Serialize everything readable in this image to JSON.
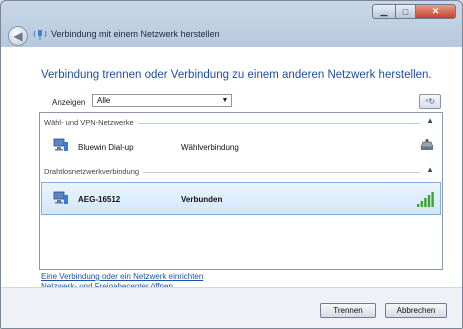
{
  "window": {
    "title": "Verbindung mit einem Netzwerk herstellen"
  },
  "main": {
    "heading": "Verbindung trennen oder Verbindung zu einem anderen Netzwerk herstellen.",
    "filter": {
      "label": "Anzeigen",
      "value": "Alle"
    },
    "groups": [
      {
        "name": "Wähl- und VPN-Netzwerke"
      },
      {
        "name": "Drahtlosnetzwerkverbindung"
      }
    ],
    "connections": [
      {
        "name": "Bluewin Dial-up",
        "status": "Wählverbindung",
        "icon": "modem-icon"
      },
      {
        "name": "AEG-16512",
        "status": "Verbunden",
        "icon": "signal-strength-icon",
        "signal_bars": 5
      }
    ],
    "links": [
      "Eine Verbindung oder ein Netzwerk einrichten",
      "Netzwerk- und Freigabecenter öffnen"
    ]
  },
  "footer": {
    "disconnect_label": "Trennen",
    "cancel_label": "Abbrechen"
  },
  "colors": {
    "heading": "#1f4f99",
    "link": "#1b53a8",
    "selection": "#d2e7fa",
    "signal": "#3aa62f"
  }
}
